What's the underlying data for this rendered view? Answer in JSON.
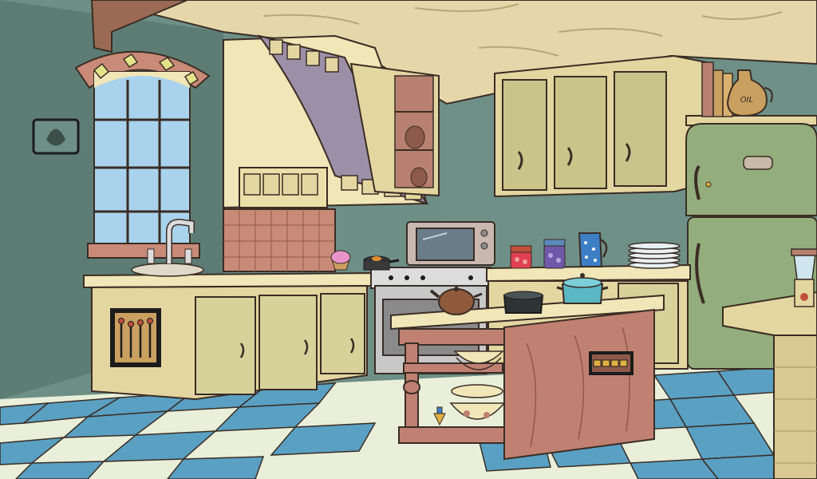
{
  "scene": {
    "name": "kitchen-escape-room",
    "colors": {
      "wall": "#6e8f86",
      "wall_dark": "#4f6d66",
      "ceiling": "#e6d7ab",
      "floor_blue": "#5aa0c2",
      "floor_cream": "#e9efd9",
      "cabinet": "#e3d6a0",
      "cabinet_door": "#c9c48a",
      "counter_top": "#f1e6b8",
      "hood": "#9c90a8",
      "tile": "#c98a78",
      "fridge": "#93ad7c",
      "island": "#c08172",
      "outline": "#3a2d25"
    }
  },
  "items": {
    "oil_jug_label": "OIL",
    "window_icon": "window-icon",
    "faucet_icon": "faucet-icon",
    "wall_plaque_icon": "leaf-plaque-icon",
    "switch_panel_icon": "lever-panel-icon",
    "oven_icon": "toaster-oven-icon",
    "cupcake_icon": "cupcake-icon",
    "saucepan_icon": "saucepan-icon",
    "jar_red_icon": "strawberry-jam-jar-icon",
    "jar_purple_icon": "grape-jam-jar-icon",
    "pitcher_icon": "blue-pitcher-icon",
    "plates_icon": "plate-stack-icon",
    "teapot_icon": "teapot-icon",
    "wok_icon": "black-pot-icon",
    "dutch_oven_icon": "teal-pot-icon",
    "bowls_icon": "bowl-stack-icon",
    "spinning_top_icon": "spinning-top-icon",
    "button_panel_icon": "four-button-panel-icon",
    "blender_icon": "blender-icon",
    "fridge_icon": "refrigerator-icon",
    "books_icon": "books-icon"
  }
}
